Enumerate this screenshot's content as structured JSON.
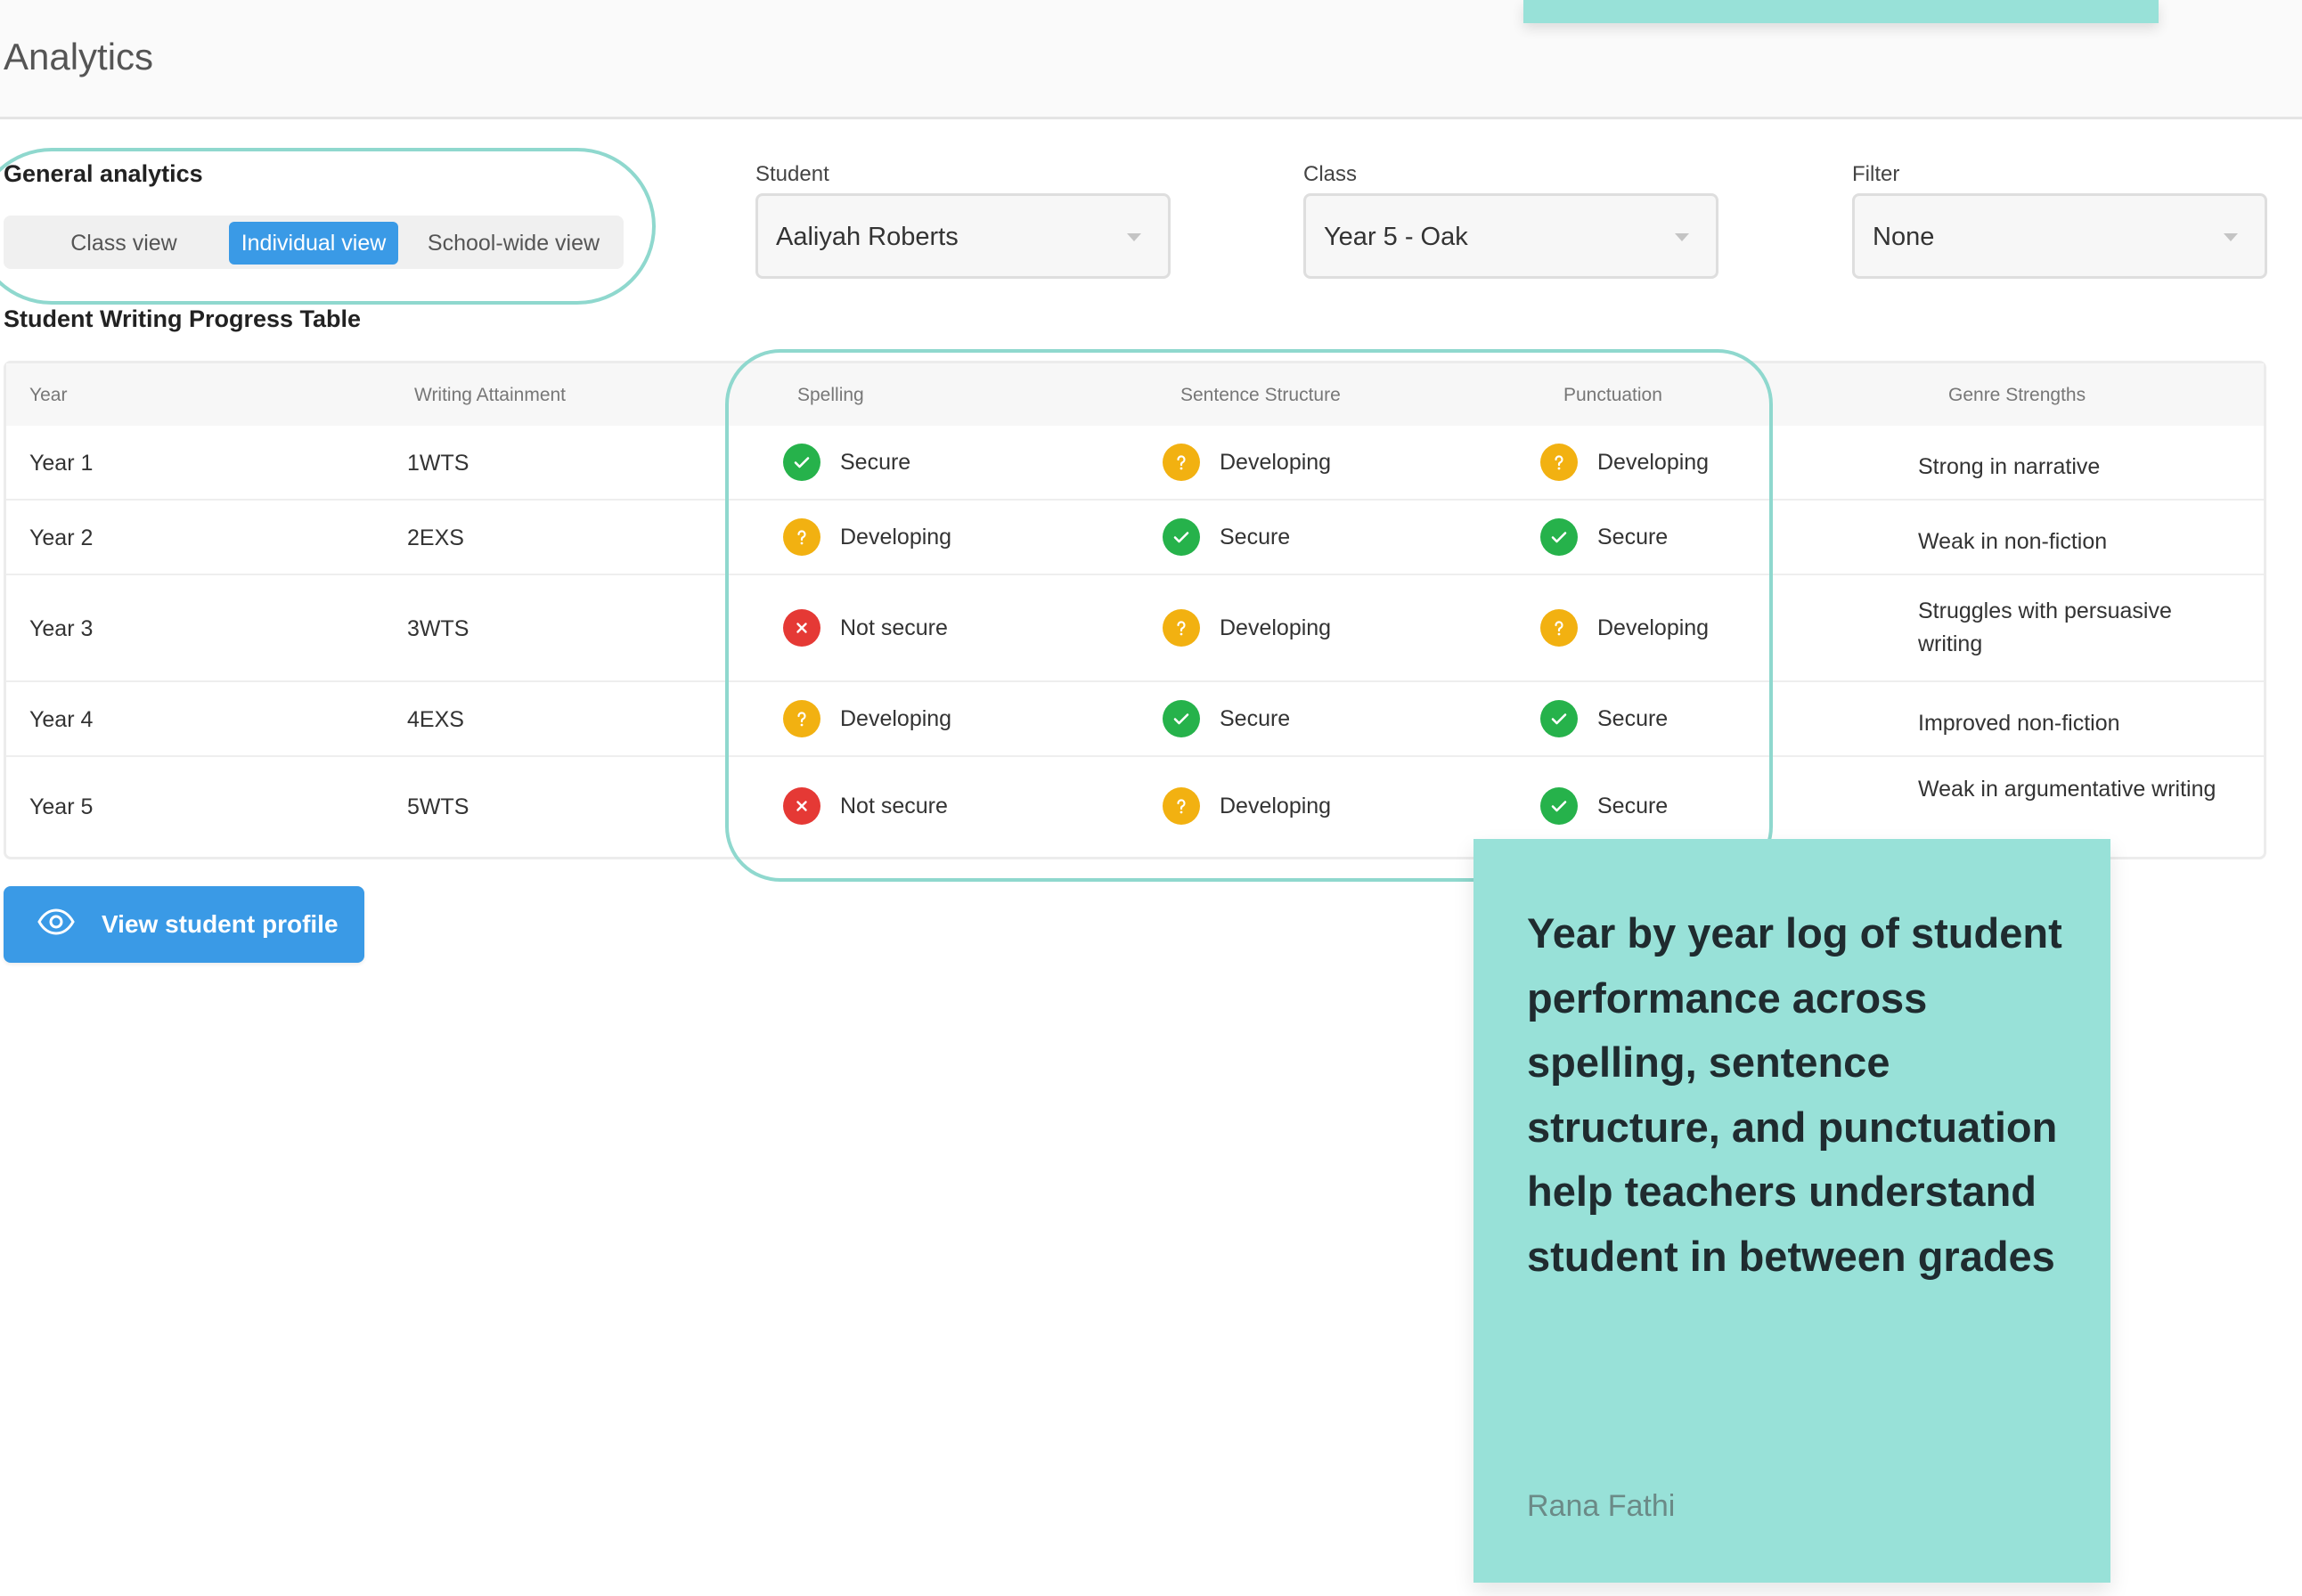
{
  "page": {
    "title": "Analytics"
  },
  "general_analytics": {
    "label": "General analytics",
    "views": [
      "Class view",
      "Individual view",
      "School-wide view"
    ],
    "selected": "Individual view"
  },
  "filters": {
    "student": {
      "label": "Student",
      "value": "Aaliyah Roberts"
    },
    "class": {
      "label": "Class",
      "value": "Year 5 - Oak"
    },
    "filter": {
      "label": "Filter",
      "value": "None"
    }
  },
  "table": {
    "title": "Student Writing Progress Table",
    "columns": [
      "Year",
      "Writing Attainment",
      "Spelling",
      "Sentence Structure",
      "Punctuation",
      "Genre Strengths"
    ],
    "rows": [
      {
        "year": "Year 1",
        "attainment": "1WTS",
        "spelling": "Secure",
        "sentence": "Developing",
        "punctuation": "Developing",
        "genre": "Strong in narrative"
      },
      {
        "year": "Year 2",
        "attainment": "2EXS",
        "spelling": "Developing",
        "sentence": "Secure",
        "punctuation": "Secure",
        "genre": "Weak in non-fiction"
      },
      {
        "year": "Year 3",
        "attainment": "3WTS",
        "spelling": "Not secure",
        "sentence": "Developing",
        "punctuation": "Developing",
        "genre": "Struggles with persuasive writing"
      },
      {
        "year": "Year 4",
        "attainment": "4EXS",
        "spelling": "Developing",
        "sentence": "Secure",
        "punctuation": "Secure",
        "genre": "Improved non-fiction"
      },
      {
        "year": "Year 5",
        "attainment": "5WTS",
        "spelling": "Not secure",
        "sentence": "Developing",
        "punctuation": "Secure",
        "genre": "Weak in argumentative writing"
      }
    ]
  },
  "actions": {
    "view_profile": "View student profile"
  },
  "quote": {
    "text": "Year by year log of student performance across spelling, sentence structure, and punctuation help teachers understand student in between grades",
    "author": "Rana Fathi"
  },
  "colors": {
    "accent": "#3a9ae6",
    "highlight": "#98e1d8",
    "secure": "#26b24b",
    "developing": "#f2b111",
    "not_secure": "#e53935"
  },
  "icons": {
    "secure": "check-circle-icon",
    "developing": "question-circle-icon",
    "not_secure": "x-circle-icon",
    "profile_button": "eye-icon",
    "dropdown": "caret-down-icon"
  }
}
